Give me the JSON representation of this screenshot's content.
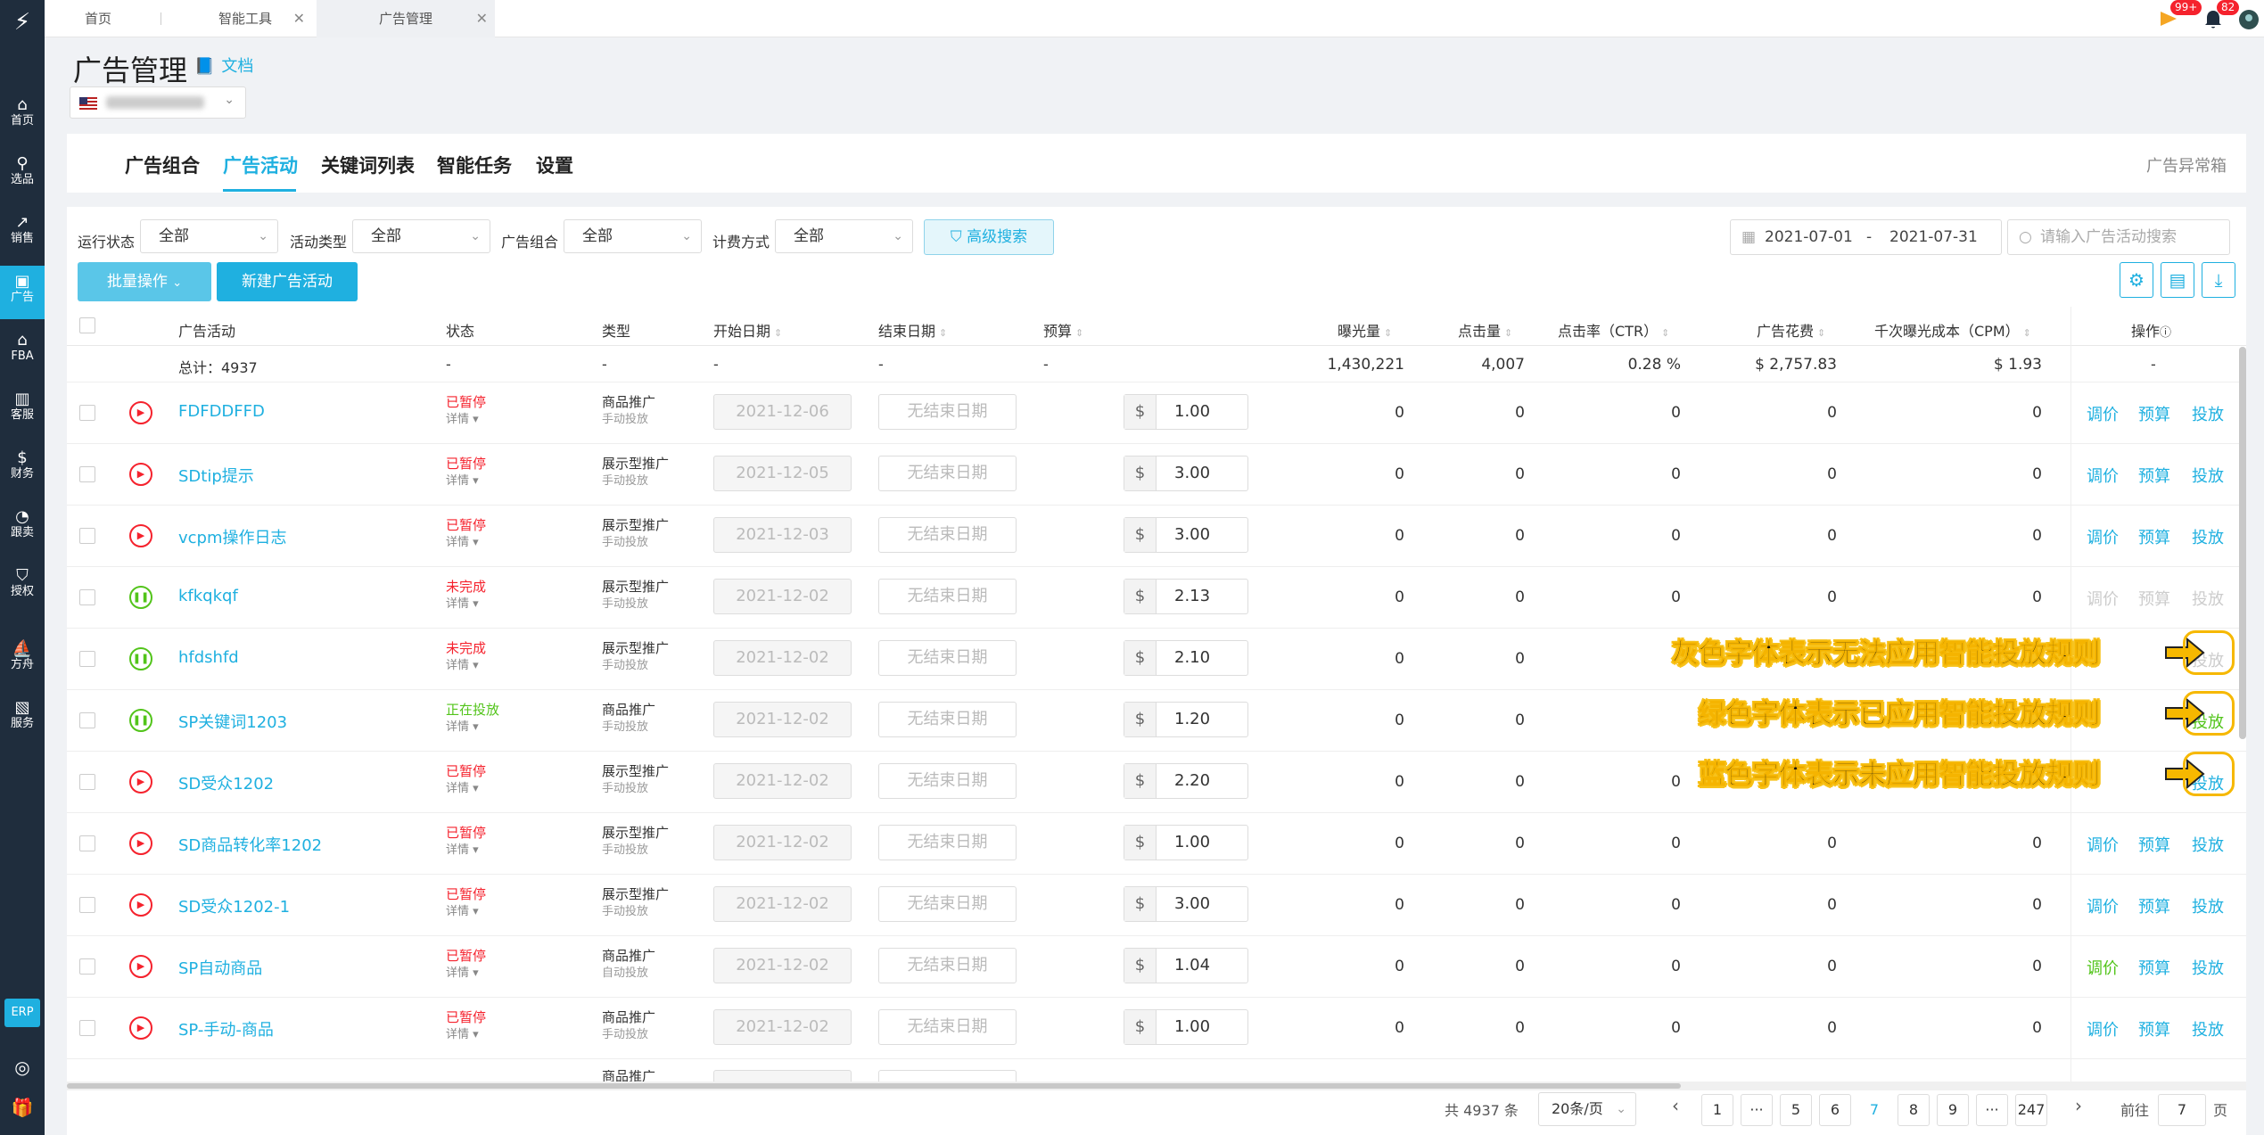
{
  "sidebar": {
    "items": [
      {
        "label": "首页",
        "icon": "home-icon"
      },
      {
        "label": "选品",
        "icon": "search-icon"
      },
      {
        "label": "销售",
        "icon": "chart-icon"
      },
      {
        "label": "广告",
        "icon": "ad-icon"
      },
      {
        "label": "FBA",
        "icon": "warehouse-icon"
      },
      {
        "label": "客服",
        "icon": "service-icon"
      },
      {
        "label": "财务",
        "icon": "finance-icon"
      },
      {
        "label": "跟卖",
        "icon": "follow-sell-icon"
      },
      {
        "label": "授权",
        "icon": "shield-icon"
      },
      {
        "label": "方舟",
        "icon": "ark-icon"
      },
      {
        "label": "服务",
        "icon": "service-bag-icon"
      }
    ],
    "erp": "ERP"
  },
  "tabs": [
    {
      "label": "首页"
    },
    {
      "label": "智能工具"
    },
    {
      "label": "广告管理"
    }
  ],
  "header": {
    "flag_count": "99+",
    "bell_count": "82"
  },
  "page": {
    "title": "广告管理",
    "doc_link": "文档"
  },
  "main_tabs": [
    "广告组合",
    "广告活动",
    "关键词列表",
    "智能任务",
    "设置"
  ],
  "abnormal_box": "广告异常箱",
  "filters": {
    "status_label": "运行状态",
    "status_value": "全部",
    "type_label": "活动类型",
    "type_value": "全部",
    "portfolio_label": "广告组合",
    "portfolio_value": "全部",
    "billing_label": "计费方式",
    "billing_value": "全部",
    "advanced": "高级搜索",
    "date_start": "2021-07-01",
    "date_sep": "-",
    "date_end": "2021-07-31",
    "search_placeholder": "请输入广告活动搜索"
  },
  "buttons": {
    "batch": "批量操作",
    "new_campaign": "新建广告活动"
  },
  "table": {
    "headers": {
      "campaign": "广告活动",
      "status": "状态",
      "type": "类型",
      "start": "开始日期",
      "end": "结束日期",
      "budget": "预算",
      "impressions": "曝光量",
      "clicks": "点击量",
      "ctr": "点击率（CTR）",
      "spend": "广告花费",
      "cpm": "千次曝光成本（CPM）",
      "ops": "操作"
    },
    "summary": {
      "label": "总计：4937",
      "status": "-",
      "type": "-",
      "start": "-",
      "end": "-",
      "budget": "-",
      "impressions": "1,430,221",
      "clicks": "4,007",
      "ctr": "0.28 %",
      "spend": "$ 2,757.83",
      "cpm": "$ 1.93",
      "ops": "-"
    },
    "rows": [
      {
        "name": "FDFDDFFD",
        "status": "已暂停",
        "status_color": "red",
        "icon": "red",
        "type": "商品推广",
        "mode": "手动投放",
        "start": "2021-12-06",
        "end": "无结束日期",
        "budget": "1.00",
        "imp": "0",
        "clk": "0",
        "ctr": "0",
        "spend": "0",
        "cpm": "0",
        "op_color": "blue"
      },
      {
        "name": "SDtip提示",
        "status": "已暂停",
        "status_color": "red",
        "icon": "red",
        "type": "展示型推广",
        "mode": "手动投放",
        "start": "2021-12-05",
        "end": "无结束日期",
        "budget": "3.00",
        "imp": "0",
        "clk": "0",
        "ctr": "0",
        "spend": "0",
        "cpm": "0",
        "op_color": "blue"
      },
      {
        "name": "vcpm操作日志",
        "status": "已暂停",
        "status_color": "red",
        "icon": "red",
        "type": "展示型推广",
        "mode": "手动投放",
        "start": "2021-12-03",
        "end": "无结束日期",
        "budget": "3.00",
        "imp": "0",
        "clk": "0",
        "ctr": "0",
        "spend": "0",
        "cpm": "0",
        "op_color": "blue"
      },
      {
        "name": "kfkqkqf",
        "status": "未完成",
        "status_color": "red",
        "icon": "green",
        "type": "展示型推广",
        "mode": "手动投放",
        "start": "2021-12-02",
        "end": "无结束日期",
        "budget": "2.13",
        "imp": "0",
        "clk": "0",
        "ctr": "0",
        "spend": "0",
        "cpm": "0",
        "op_color": "gray"
      },
      {
        "name": "hfdshfd",
        "status": "未完成",
        "status_color": "red",
        "icon": "green",
        "type": "展示型推广",
        "mode": "手动投放",
        "start": "2021-12-02",
        "end": "无结束日期",
        "budget": "2.10",
        "imp": "0",
        "clk": "0",
        "ctr": "",
        "spend": "",
        "cpm": "",
        "op_color": "gray"
      },
      {
        "name": "SP关键词1203",
        "status": "正在投放",
        "status_color": "green",
        "icon": "green",
        "type": "商品推广",
        "mode": "手动投放",
        "start": "2021-12-02",
        "end": "无结束日期",
        "budget": "1.20",
        "imp": "0",
        "clk": "0",
        "ctr": "",
        "spend": "",
        "cpm": "",
        "op_color": "green"
      },
      {
        "name": "SD受众1202",
        "status": "已暂停",
        "status_color": "red",
        "icon": "red",
        "type": "展示型推广",
        "mode": "手动投放",
        "start": "2021-12-02",
        "end": "无结束日期",
        "budget": "2.20",
        "imp": "0",
        "clk": "0",
        "ctr": "0",
        "spend": "",
        "cpm": "",
        "op_color": "blue"
      },
      {
        "name": "SD商品转化率1202",
        "status": "已暂停",
        "status_color": "red",
        "icon": "red",
        "type": "展示型推广",
        "mode": "手动投放",
        "start": "2021-12-02",
        "end": "无结束日期",
        "budget": "1.00",
        "imp": "0",
        "clk": "0",
        "ctr": "0",
        "spend": "0",
        "cpm": "0",
        "op_color": "blue"
      },
      {
        "name": "SD受众1202-1",
        "status": "已暂停",
        "status_color": "red",
        "icon": "red",
        "type": "展示型推广",
        "mode": "手动投放",
        "start": "2021-12-02",
        "end": "无结束日期",
        "budget": "3.00",
        "imp": "0",
        "clk": "0",
        "ctr": "0",
        "spend": "0",
        "cpm": "0",
        "op_color": "blue"
      },
      {
        "name": "SP自动商品",
        "status": "已暂停",
        "status_color": "red",
        "icon": "red",
        "type": "商品推广",
        "mode": "自动投放",
        "start": "2021-12-02",
        "end": "无结束日期",
        "budget": "1.04",
        "imp": "0",
        "clk": "0",
        "ctr": "0",
        "spend": "0",
        "cpm": "0",
        "op_color": "blue",
        "adj_green": true
      },
      {
        "name": "SP-手动-商品",
        "status": "已暂停",
        "status_color": "red",
        "icon": "red",
        "type": "商品推广",
        "mode": "手动投放",
        "start": "2021-12-02",
        "end": "无结束日期",
        "budget": "1.00",
        "imp": "0",
        "clk": "0",
        "ctr": "0",
        "spend": "0",
        "cpm": "0",
        "op_color": "blue"
      }
    ],
    "detail_label": "详情",
    "currency": "$",
    "ops": {
      "adjust": "调价",
      "budget": "预算",
      "launch": "投放"
    }
  },
  "annotations": [
    "灰色字体表示无法应用智能投放规则",
    "绿色字体表示已应用智能投放规则",
    "蓝色字体表示未应用智能投放规则"
  ],
  "pagination": {
    "total": "共 4937 条",
    "page_size": "20条/页",
    "pages": [
      "1",
      "···",
      "5",
      "6",
      "7",
      "8",
      "9",
      "···",
      "247"
    ],
    "current": "7",
    "goto_label": "前往",
    "goto_value": "7",
    "page_suffix": "页"
  },
  "colors": {
    "accent": "#1fb0e0",
    "red": "#f5222d",
    "green": "#52c41a",
    "annotation": "#f6b800",
    "sidebar": "#1f2d3d"
  }
}
